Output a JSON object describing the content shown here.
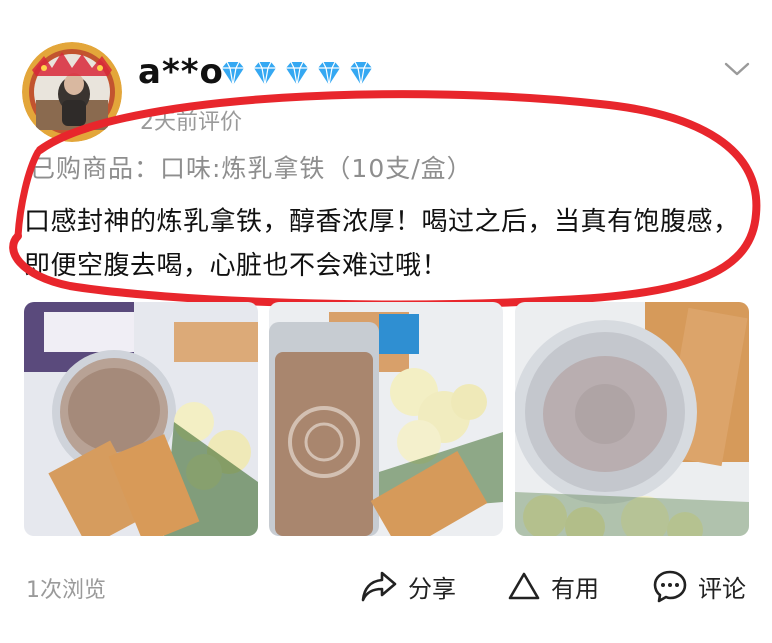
{
  "review": {
    "username": "a**o",
    "level_icons": [
      "diamond-icon",
      "diamond-icon",
      "diamond-icon",
      "diamond-icon",
      "diamond-icon"
    ],
    "time": "2天前评价",
    "product": "已购商品：口味:炼乳拿铁（10支/盒）",
    "text": "口感封神的炼乳拿铁，醇香浓厚！喝过之后，当真有饱腹感，即便空腹去喝，心脏也不会难过哦！"
  },
  "photos": [
    {
      "alt": "photo-1"
    },
    {
      "alt": "photo-2"
    },
    {
      "alt": "photo-3"
    }
  ],
  "footer": {
    "views": "1次浏览",
    "share_label": "分享",
    "useful_label": "有用",
    "comment_label": "评论"
  },
  "colors": {
    "annotation": "#e8262c",
    "diamond": "#35a8f2",
    "muted_text": "#9a9a9a"
  }
}
